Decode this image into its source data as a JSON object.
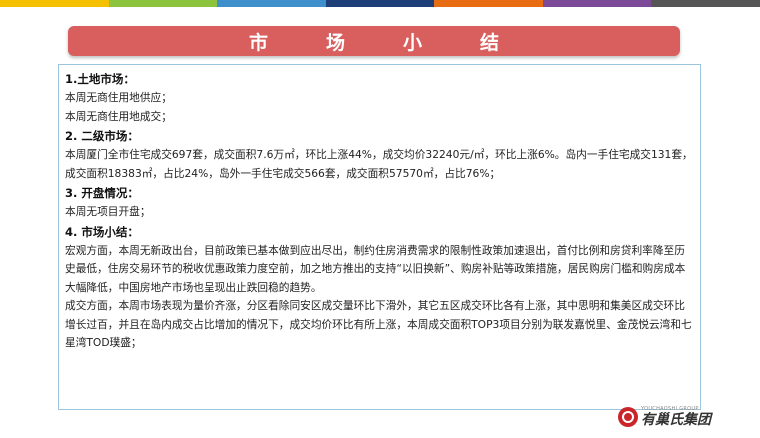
{
  "colors": {
    "top_bar": [
      "#f5c000",
      "#8dc43e",
      "#3f8fcc",
      "#1e3e78",
      "#e86c12",
      "#7c4a99",
      "#565656"
    ],
    "banner": "#d95f5f",
    "border": "#9cc6dd",
    "logo_red": "#c9252b"
  },
  "banner": {
    "title": "市场小结"
  },
  "sections": [
    {
      "heading": "1.土地市场：",
      "paragraphs": [
        "本周无商住用地供应；",
        "本周无商住用地成交；"
      ]
    },
    {
      "heading": "2. 二级市场：",
      "paragraphs": [
        "本周厦门全市住宅成交697套，成交面积7.6万㎡，环比上涨44%，成交均价32240元/㎡，环比上涨6%。岛内一手住宅成交131套，成交面积18383㎡，占比24%，岛外一手住宅成交566套，成交面积57570㎡，占比76%；"
      ]
    },
    {
      "heading": "3. 开盘情况：",
      "paragraphs": [
        "本周无项目开盘；"
      ]
    },
    {
      "heading": "4. 市场小结：",
      "paragraphs": [
        "宏观方面，本周无新政出台，目前政策已基本做到应出尽出，制约住房消费需求的限制性政策加速退出，首付比例和房贷利率降至历史最低，住房交易环节的税收优惠政策力度空前，加之地方推出的支持“以旧换新”、购房补贴等政策措施，居民购房门槛和购房成本大幅降低，中国房地产市场也呈现出止跌回稳的趋势。",
        "成交方面，本周市场表现为量价齐涨，分区看除同安区成交量环比下滑外，其它五区成交环比各有上涨，其中思明和集美区成交环比增长过百，并且在岛内成交占比增加的情况下，成交均价环比有所上涨，本周成交面积TOP3项目分别为联发嘉悦里、金茂悦云湾和七星湾TOD璞盛；"
      ]
    }
  ],
  "logo": {
    "en": "YOUCHAOSHI GROUP",
    "cn": "有巢氏集团",
    "icon": "brand-circle-icon"
  }
}
